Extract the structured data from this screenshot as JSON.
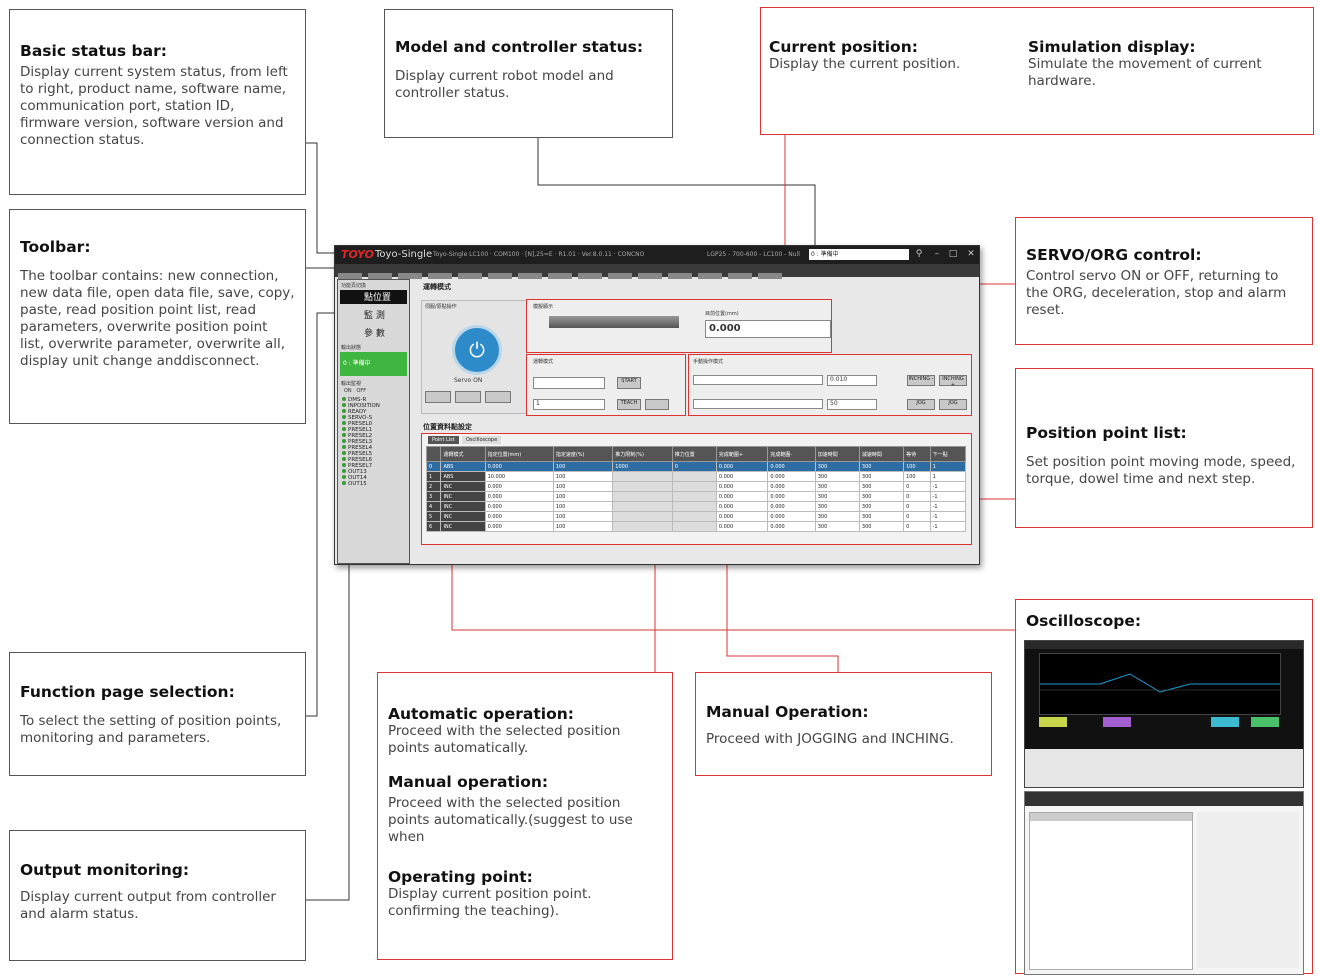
{
  "annotations": {
    "basic_status": {
      "title": "Basic status bar:",
      "body": "Display current system status, from left to right, product name, software name, communication port, station ID, firmware version, software version and connection status."
    },
    "toolbar": {
      "title": "Toolbar:",
      "body": "The toolbar contains: new connection, new data file, open data file, save, copy, paste, read position point list, read parameters, overwrite position point list, overwrite parameter, overwrite all, display unit change anddisconnect."
    },
    "function_page": {
      "title": "Function page selection:",
      "body": "To select the setting of position points, monitoring and parameters."
    },
    "output_monitoring": {
      "title": "Output monitoring:",
      "body": "Display current output from controller and alarm status."
    },
    "model_status": {
      "title": "Model and controller status:",
      "body": "Display current robot model and controller status."
    },
    "current_position": {
      "title": "Current position:",
      "body": "Display the current position."
    },
    "simulation": {
      "title": "Simulation display:",
      "body": "Simulate the movement of current hardware."
    },
    "servo_org": {
      "title": "SERVO/ORG control:",
      "body": "Control servo ON or OFF, returning to the ORG, deceleration, stop and alarm reset."
    },
    "position_list": {
      "title": "Position point list:",
      "body": "Set position point moving mode, speed, torque, dowel time and next step."
    },
    "oscilloscope": {
      "title": "Oscilloscope:"
    },
    "auto_op": {
      "title": "Automatic operation:",
      "body": "Proceed with the selected position points automatically."
    },
    "manual_op_lower": {
      "title": "Manual operation:",
      "body": "Proceed with the selected position points automatically.(suggest to use when"
    },
    "operating_point": {
      "title": "Operating point:",
      "body": "Display current position point. confirming the teaching)."
    },
    "manual_op": {
      "title": "Manual Operation:",
      "body": "Proceed with JOGGING and INCHING."
    }
  },
  "app": {
    "logo": "TOYO",
    "name": "Toyo-Single",
    "info": "Toyo-Single LC100 · COM100 · [N],25=E · R1.01 · Ver.8.0.11 · CONCNO",
    "model": "LGP25 - 700-600 - LC100 - Null",
    "status": "0 : 準備中",
    "sidebar": {
      "header": "功能頁切換",
      "tabs": [
        "點位置",
        "監  測",
        "參  數"
      ],
      "output_header": "輸出狀態",
      "active": "0 : 準備中",
      "io_header": "輸出監視",
      "io_legend": [
        "ON",
        "OFF"
      ],
      "io": [
        "DMS-R",
        "INPOSITION",
        "READY",
        "SERVO-S",
        "PRESEL0",
        "PRESEL1",
        "PRESEL2",
        "PRESEL3",
        "PRESEL4",
        "PRESEL5",
        "PRESEL6",
        "PRESEL7",
        "OUT13",
        "OUT14",
        "OUT15"
      ]
    },
    "sections": {
      "op_mode": "運轉模式",
      "servo_panel": "伺服/原點操作",
      "servo_on": "Servo ON",
      "sim_panel": "模擬顯示",
      "cur_pos_label": "目前位置(mm)",
      "cur_pos": "0.000",
      "run_panel": "運轉模式",
      "teach": "TEACH",
      "start": "START",
      "op_point": "1",
      "manual_panel": "手動操作模式",
      "inching_value": "0.010",
      "jog_value": "50",
      "jog": "JOG",
      "inching_minus": "INCHING -",
      "inching_plus": "INCHING +",
      "list_title": "位置資料點設定",
      "tabs": [
        "Point List",
        "Oscilloscope"
      ]
    },
    "table": {
      "headers": [
        "",
        "運轉模式",
        "指定位置(mm)",
        "指定速度(%)",
        "推力限制(%)",
        "推力位置",
        "完成範圍+",
        "完成範圍-",
        "加速時間",
        "減速時間",
        "等待",
        "下一點"
      ],
      "rows": [
        [
          "0",
          "ABS",
          "0.000",
          "100",
          "1000",
          "0",
          "0.000",
          "0.000",
          "300",
          "300",
          "100",
          "1"
        ],
        [
          "1",
          "ABS",
          "10.000",
          "100",
          "",
          "",
          "0.000",
          "0.000",
          "300",
          "300",
          "100",
          "1"
        ],
        [
          "2",
          "INC",
          "0.000",
          "100",
          "",
          "",
          "0.000",
          "0.000",
          "300",
          "300",
          "0",
          "-1"
        ],
        [
          "3",
          "INC",
          "0.000",
          "100",
          "",
          "",
          "0.000",
          "0.000",
          "300",
          "300",
          "0",
          "-1"
        ],
        [
          "4",
          "INC",
          "0.000",
          "100",
          "",
          "",
          "0.000",
          "0.000",
          "300",
          "300",
          "0",
          "-1"
        ],
        [
          "5",
          "INC",
          "0.000",
          "100",
          "",
          "",
          "0.000",
          "0.000",
          "300",
          "300",
          "0",
          "-1"
        ],
        [
          "6",
          "INC",
          "0.000",
          "100",
          "",
          "",
          "0.000",
          "0.000",
          "300",
          "300",
          "0",
          "-1"
        ]
      ]
    }
  }
}
